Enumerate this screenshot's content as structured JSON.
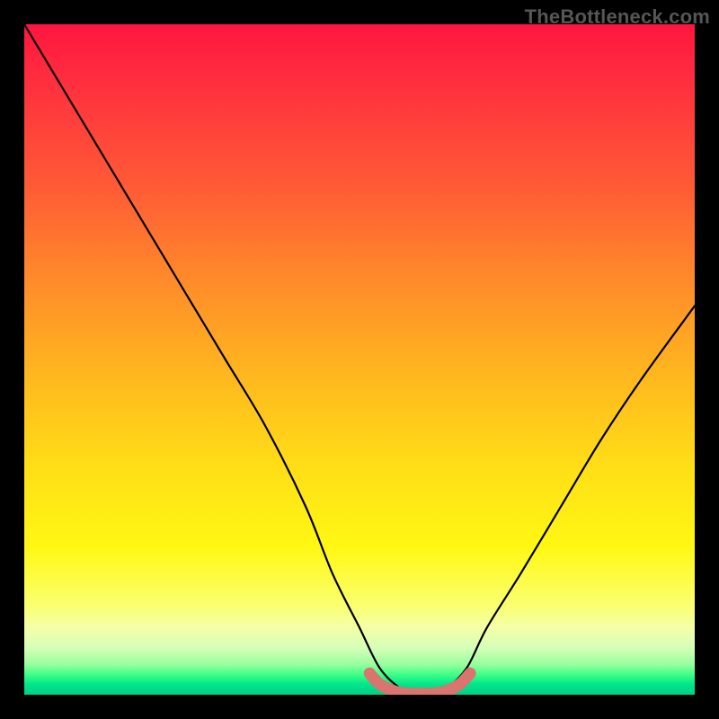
{
  "watermark": "TheBottleneck.com",
  "chart_data": {
    "type": "line",
    "title": "",
    "xlabel": "",
    "ylabel": "",
    "xlim": [
      0,
      100
    ],
    "ylim": [
      0,
      100
    ],
    "grid": false,
    "series": [
      {
        "name": "bottleneck-curve",
        "x": [
          0,
          6,
          12,
          18,
          24,
          30,
          36,
          42,
          46,
          50,
          53,
          56,
          58,
          60,
          63,
          66,
          69,
          74,
          80,
          86,
          92,
          100
        ],
        "percent": [
          100,
          90,
          80,
          70,
          60,
          50,
          40,
          28,
          18,
          10,
          4,
          1,
          0,
          0,
          1,
          4,
          10,
          18,
          28,
          38,
          47,
          58
        ]
      },
      {
        "name": "optimal-zone",
        "x": [
          51.5,
          53,
          55,
          57,
          59,
          61,
          63,
          65,
          66.5
        ],
        "percent": [
          3.2,
          1.6,
          0.6,
          0.2,
          0.2,
          0.2,
          0.6,
          1.6,
          3.2
        ]
      }
    ],
    "colors": {
      "curve": "#000000",
      "optimal": "#d9746f",
      "gradient_top": "#ff153f",
      "gradient_bottom": "#00cf86"
    }
  }
}
